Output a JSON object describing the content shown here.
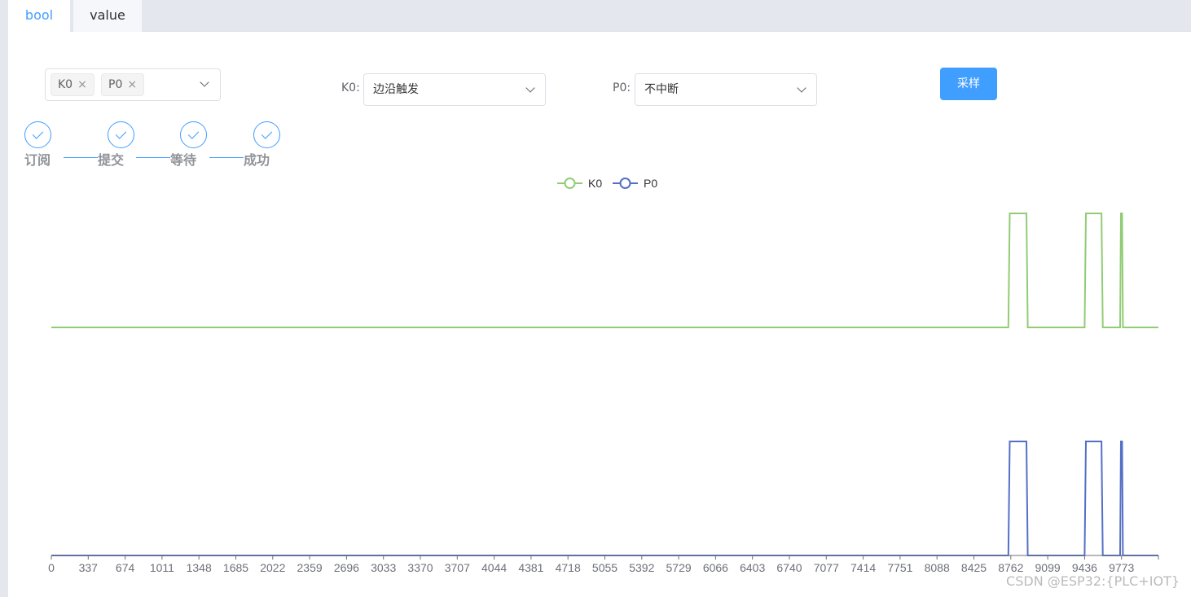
{
  "tabs": [
    {
      "label": "bool",
      "active": true
    },
    {
      "label": "value",
      "active": false
    }
  ],
  "channel_select": {
    "tags": [
      "K0",
      "P0"
    ],
    "remove_glyph": "×"
  },
  "k0_mode": {
    "label": "K0:",
    "value": "边沿触发"
  },
  "p0_mode": {
    "label": "P0:",
    "value": "不中断"
  },
  "sample_button": "采样",
  "steps": [
    "订阅",
    "提交",
    "等待",
    "成功"
  ],
  "colors": {
    "accent": "#409eff",
    "k0": "#91cc75",
    "p0": "#5470c6"
  },
  "watermark": "CSDN @ESP32:{PLC+IOT}",
  "chart_data": {
    "type": "line",
    "legend": [
      "K0",
      "P0"
    ],
    "legend_position": "top-center",
    "x_tick_labels": [
      "0",
      "337",
      "674",
      "1011",
      "1348",
      "1685",
      "2022",
      "2359",
      "2696",
      "3033",
      "3370",
      "3707",
      "4044",
      "4381",
      "4718",
      "5055",
      "5392",
      "5729",
      "6066",
      "6403",
      "6740",
      "7077",
      "7414",
      "7751",
      "8088",
      "8425",
      "8762",
      "9099",
      "9436",
      "9773"
    ],
    "xlim": [
      0,
      10110
    ],
    "series": [
      {
        "name": "K0",
        "color": "#91cc75",
        "x": [
          0,
          8740,
          8752,
          8905,
          8917,
          9436,
          9448,
          9590,
          9602,
          9760,
          9768,
          9778,
          9786,
          10110
        ],
        "values": [
          0,
          0,
          1,
          1,
          0,
          0,
          1,
          1,
          0,
          0,
          1,
          1,
          0,
          0
        ]
      },
      {
        "name": "P0",
        "color": "#5470c6",
        "x": [
          0,
          8740,
          8752,
          8905,
          8917,
          9436,
          9448,
          9590,
          9602,
          9760,
          9768,
          9778,
          9786,
          10110
        ],
        "values": [
          0,
          0,
          1,
          1,
          0,
          0,
          1,
          1,
          0,
          0,
          1,
          1,
          0,
          0
        ]
      }
    ]
  }
}
